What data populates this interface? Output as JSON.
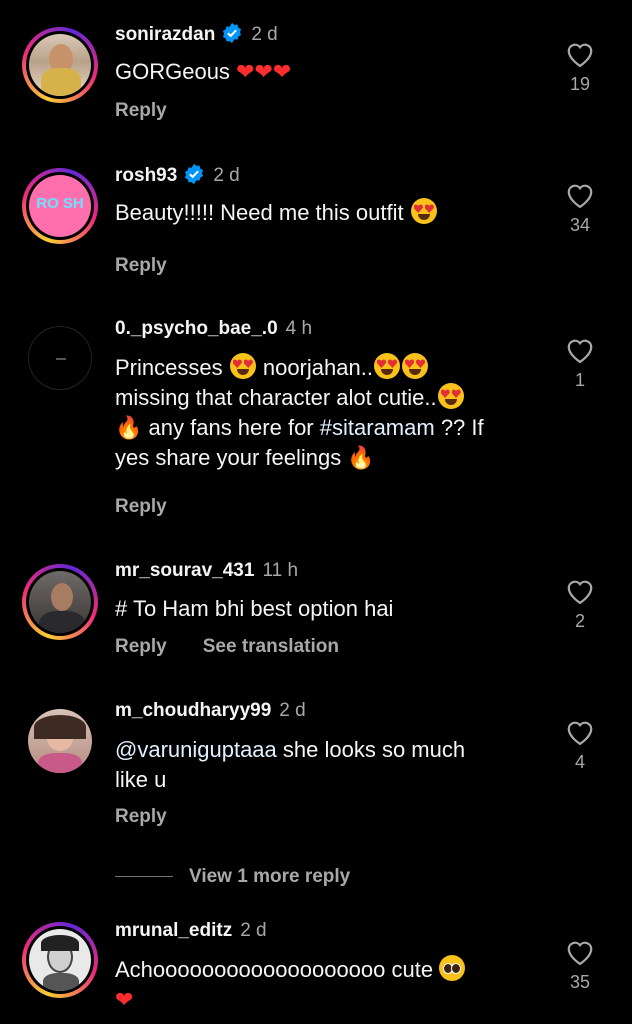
{
  "comments": [
    {
      "username": "sonirazdan",
      "time": "2 d",
      "verified": true,
      "text": "GORGeous",
      "reply_label": "Reply",
      "likes": "19"
    },
    {
      "username": "rosh93",
      "time": "2 d",
      "verified": true,
      "text": "Beauty!!!!! Need me this outfit",
      "reply_label": "Reply",
      "likes": "34",
      "avatar_text": "RO SH"
    },
    {
      "username": "0._psycho_bae_.0",
      "time": "4 h",
      "verified": false,
      "text_line1a": "Princesses",
      "text_line1b": "noorjahan..",
      "text_line2": "missing that character alot  cutie..",
      "text_line3a": "any fans here for",
      "hashtag": "#sitaramam",
      "text_line3b": "?? If",
      "text_line4": "yes share your feelings",
      "reply_label": "Reply",
      "likes": "1"
    },
    {
      "username": "mr_sourav_431",
      "time": "11 h",
      "verified": false,
      "text": "# To Ham bhi best option hai",
      "reply_label": "Reply",
      "translate_label": "See translation",
      "likes": "2"
    },
    {
      "username": "m_choudharyy99",
      "time": "2 d",
      "verified": false,
      "mention": "@varuniguptaaa",
      "text_a": "she looks so much",
      "text_b": "like u",
      "reply_label": "Reply",
      "likes": "4"
    },
    {
      "username": "mrunal_editz",
      "time": "2 d",
      "verified": false,
      "text": "Achooooooooooooooooooo cute",
      "likes": "35"
    }
  ],
  "view_more_label": "View 1 more reply",
  "colors": {
    "background": "#000000",
    "text": "#f5f5f5",
    "secondary": "#a8a8a8",
    "verified_blue": "#0095f6"
  },
  "icons": [
    "heart-outline-icon",
    "verified-badge-icon"
  ]
}
